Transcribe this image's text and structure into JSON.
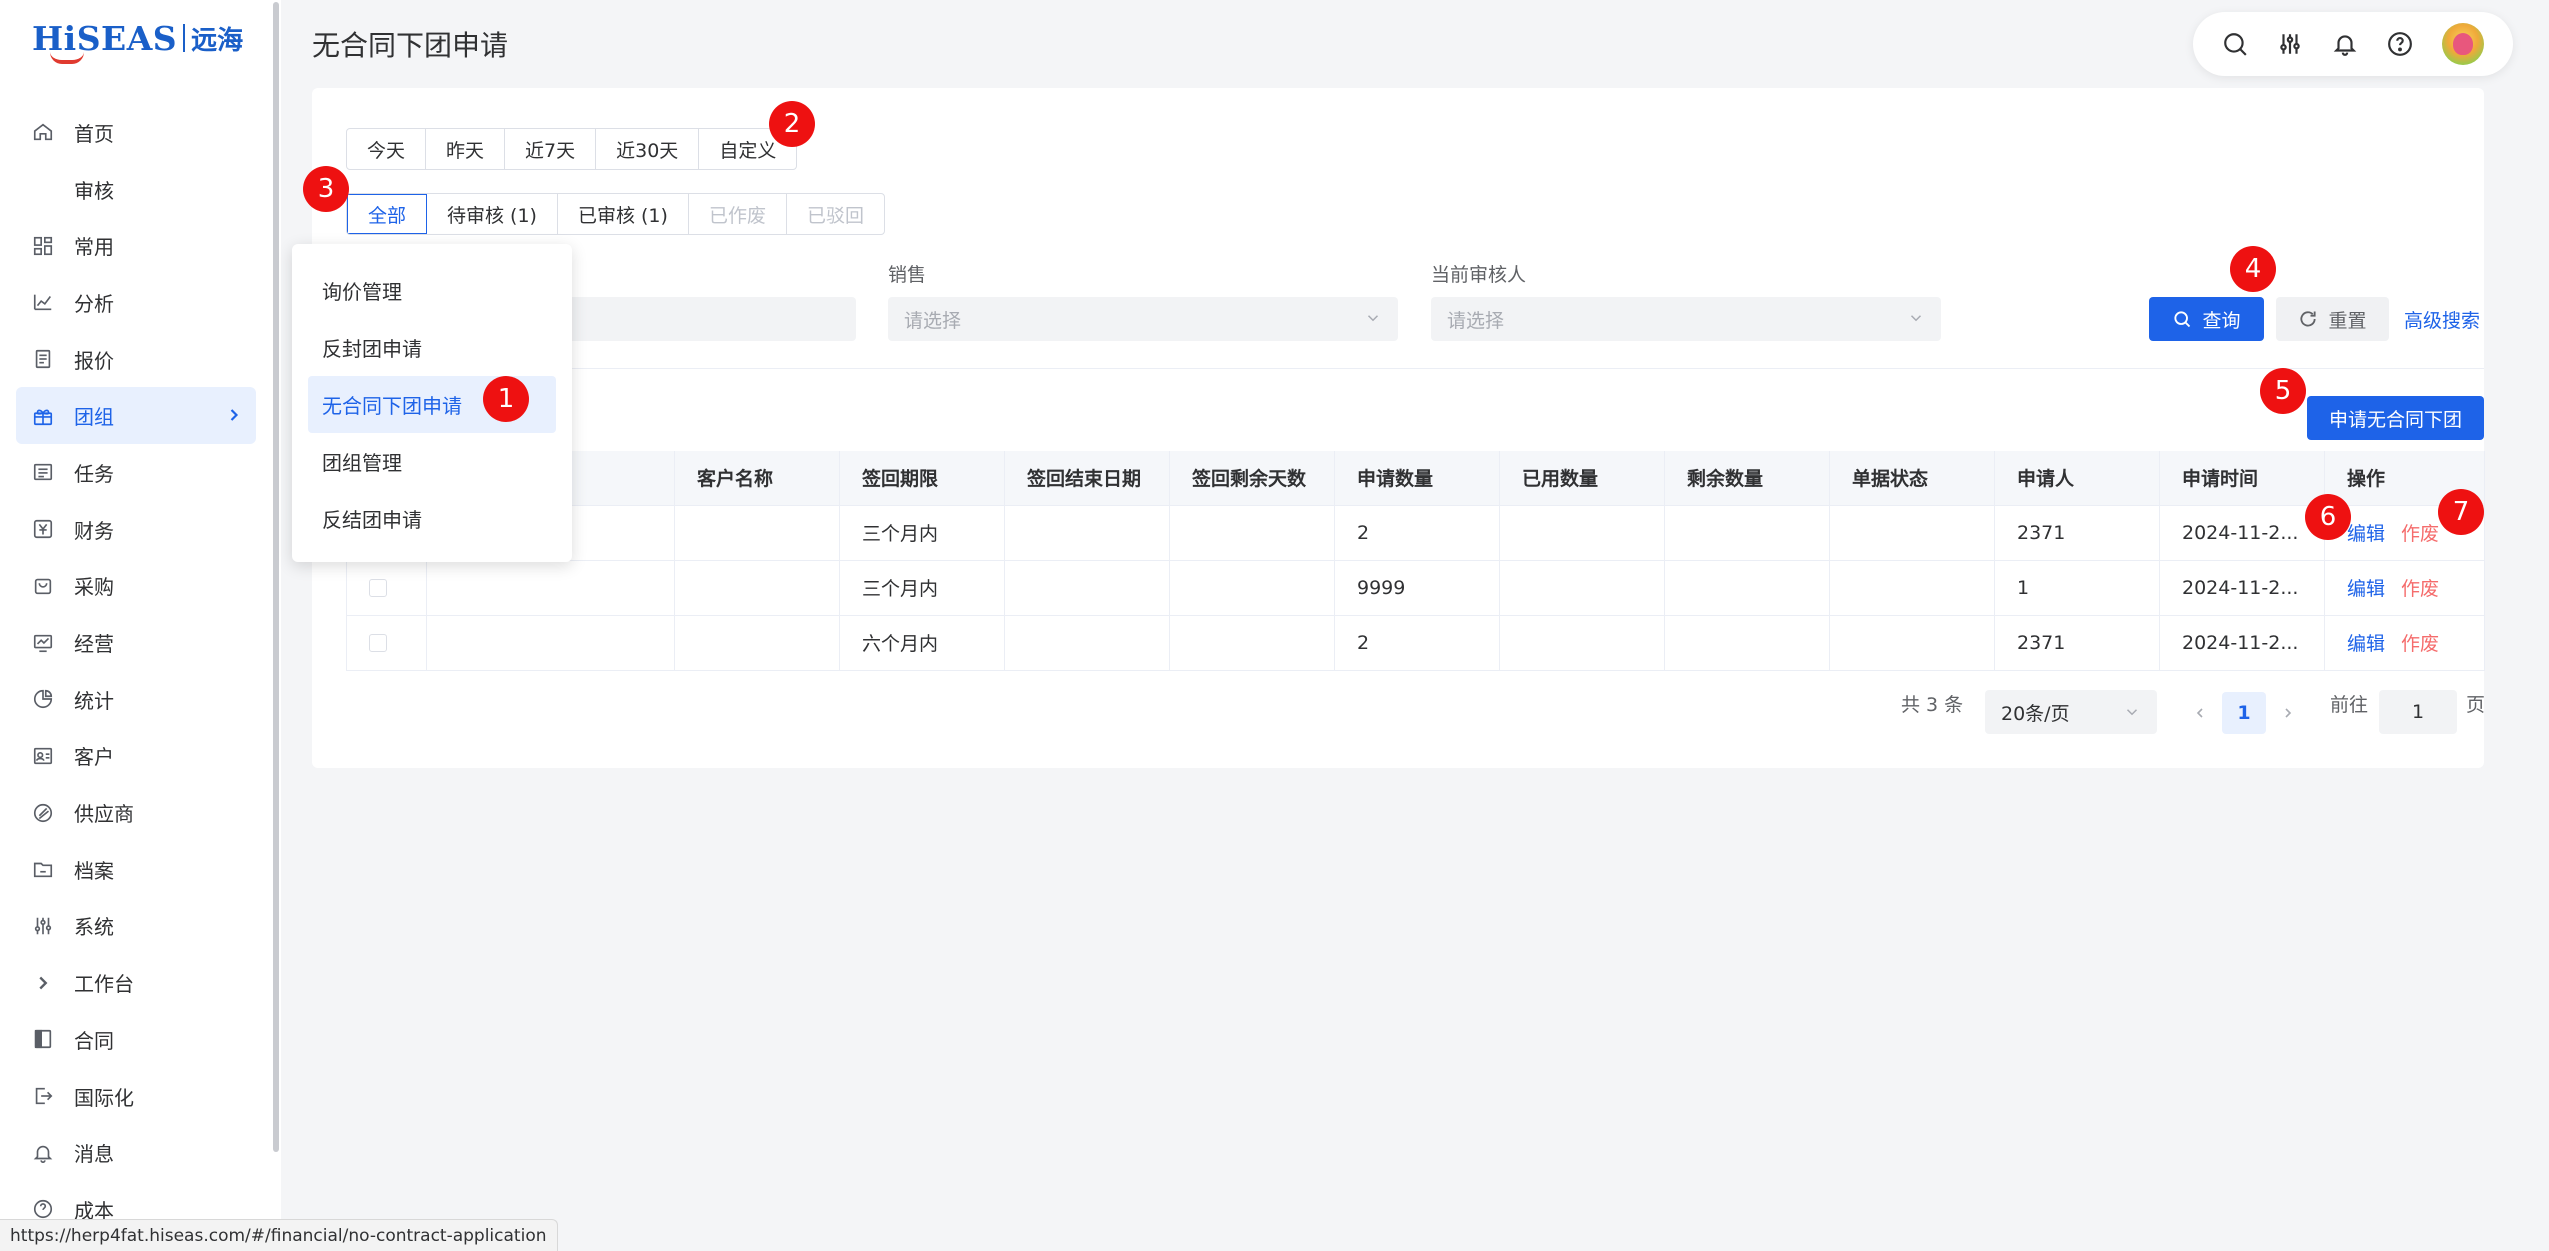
{
  "logo": {
    "brand": "HiSEAS",
    "cn": "远海"
  },
  "sidebar": {
    "items": [
      {
        "label": "首页",
        "icon": "home-icon"
      },
      {
        "label": "审核",
        "icon": ""
      },
      {
        "label": "常用",
        "icon": "grid-icon"
      },
      {
        "label": "分析",
        "icon": "chart-icon"
      },
      {
        "label": "报价",
        "icon": "document-icon"
      },
      {
        "label": "团组",
        "icon": "gift-icon",
        "active": true
      },
      {
        "label": "任务",
        "icon": "list-icon"
      },
      {
        "label": "财务",
        "icon": "yen-icon"
      },
      {
        "label": "采购",
        "icon": "cart-icon"
      },
      {
        "label": "经营",
        "icon": "monitor-icon"
      },
      {
        "label": "统计",
        "icon": "pie-icon"
      },
      {
        "label": "客户",
        "icon": "user-card-icon"
      },
      {
        "label": "供应商",
        "icon": "link-icon"
      },
      {
        "label": "档案",
        "icon": "folder-icon"
      },
      {
        "label": "系统",
        "icon": "sliders-icon"
      },
      {
        "label": "工作台",
        "icon": "chevron-right-icon"
      },
      {
        "label": "合同",
        "icon": "book-icon"
      },
      {
        "label": "国际化",
        "icon": "logout-icon"
      },
      {
        "label": "消息",
        "icon": "bell-icon"
      },
      {
        "label": "成本",
        "icon": "question-icon"
      }
    ]
  },
  "header": {
    "title": "无合同下团申请"
  },
  "date_tabs": [
    "今天",
    "昨天",
    "近7天",
    "近30天",
    "自定义"
  ],
  "status_tabs": [
    {
      "label": "全部",
      "state": "on"
    },
    {
      "label": "待审核 (1)",
      "state": ""
    },
    {
      "label": "已审核 (1)",
      "state": ""
    },
    {
      "label": "已作废",
      "state": "dis"
    },
    {
      "label": "已驳回",
      "state": "dis"
    }
  ],
  "filters": {
    "sales": {
      "label": "销售",
      "placeholder": "请选择"
    },
    "reviewer": {
      "label": "当前审核人",
      "placeholder": "请选择"
    }
  },
  "actions": {
    "query": "查询",
    "reset": "重置",
    "advanced": "高级搜索",
    "apply": "申请无合同下团"
  },
  "table": {
    "columns": [
      "",
      "",
      "客户名称",
      "签回期限",
      "签回结束日期",
      "签回剩余天数",
      "申请数量",
      "已用数量",
      "剩余数量",
      "单据状态",
      "申请人",
      "申请时间",
      "操作"
    ],
    "rows": [
      [
        "",
        "",
        "",
        "三个月内",
        "",
        "",
        "2",
        "",
        "",
        "",
        "2371",
        "2024-11-2...",
        ""
      ],
      [
        "",
        "",
        "",
        "三个月内",
        "",
        "",
        "9999",
        "",
        "",
        "",
        "1",
        "2024-11-2...",
        ""
      ],
      [
        "",
        "",
        "",
        "六个月内",
        "",
        "",
        "2",
        "",
        "",
        "",
        "2371",
        "2024-11-2...",
        ""
      ]
    ],
    "edit_label": "编辑",
    "void_label": "作废"
  },
  "pagination": {
    "total": "共 3 条",
    "page_size": "20条/页",
    "current": "1",
    "goto_label": "前往",
    "goto_value": "1",
    "page_unit": "页"
  },
  "popover": {
    "items": [
      {
        "label": "询价管理"
      },
      {
        "label": "反封团申请"
      },
      {
        "label": "无合同下团申请",
        "active": true
      },
      {
        "label": "团组管理"
      },
      {
        "label": "反结团申请"
      }
    ]
  },
  "markers": [
    "1",
    "2",
    "3",
    "4",
    "5",
    "6",
    "7"
  ],
  "statusbar": {
    "url": "https://herp4fat.hiseas.com/#/financial/no-contract-application"
  },
  "colors": {
    "primary": "#1e63e8",
    "danger": "#f56c6c",
    "marker": "#ee1111"
  }
}
